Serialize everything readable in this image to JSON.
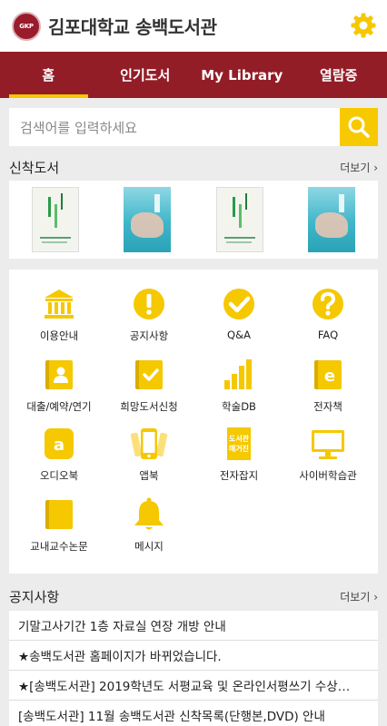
{
  "header": {
    "seal_text": "GKP",
    "title": "김포대학교 송백도서관",
    "settings_icon": "gear-icon",
    "accent_color": "#f5c800"
  },
  "nav": {
    "tabs": [
      {
        "label": "홈",
        "active": true
      },
      {
        "label": "인기도서",
        "active": false
      },
      {
        "label": "My Library",
        "active": false
      },
      {
        "label": "열람증",
        "active": false
      }
    ],
    "bar_color": "#931d27"
  },
  "search": {
    "placeholder": "검색어를 입력하세요",
    "button_icon": "search-icon"
  },
  "new_books": {
    "title": "신착도서",
    "more_label": "더보기 ›",
    "covers": [
      "green-cover",
      "teal-cover",
      "green-cover",
      "teal-cover"
    ]
  },
  "menu": {
    "icon_color": "#f5c800",
    "items": [
      {
        "label": "이용안내",
        "icon": "library-building-icon"
      },
      {
        "label": "공지사항",
        "icon": "exclamation-circle-icon"
      },
      {
        "label": "Q&A",
        "icon": "checkmark-circle-icon"
      },
      {
        "label": "FAQ",
        "icon": "question-circle-icon"
      },
      {
        "label": "대출/예약/연기",
        "icon": "person-book-icon"
      },
      {
        "label": "희망도서신청",
        "icon": "check-book-icon"
      },
      {
        "label": "학술DB",
        "icon": "bar-chart-icon"
      },
      {
        "label": "전자책",
        "icon": "ebook-icon"
      },
      {
        "label": "오디오북",
        "icon": "audiobook-icon"
      },
      {
        "label": "앱북",
        "icon": "smartphone-icon"
      },
      {
        "label": "전자잡지",
        "icon": "magazine-icon"
      },
      {
        "label": "사이버학습관",
        "icon": "monitor-icon"
      },
      {
        "label": "교내교수논문",
        "icon": "paper-book-icon"
      },
      {
        "label": "메시지",
        "icon": "bell-icon"
      }
    ],
    "magazine_icon_text": "도서관\n매거진"
  },
  "notices": {
    "title": "공지사항",
    "more_label": "더보기 ›",
    "items": [
      "기말고사기간 1층 자료실 연장 개방 안내",
      "★송백도서관 홈페이지가 바뀌었습니다.",
      "★[송백도서관] 2019학년도 서평교육 및 온라인서평쓰기 수상…",
      "[송백도서관] 11월 송백도서관 신착목록(단행본,DVD) 안내"
    ]
  }
}
